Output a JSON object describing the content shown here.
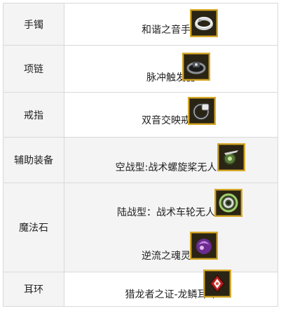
{
  "rows": [
    {
      "label": "手镯",
      "items": [
        {
          "name": "和谐之音手镯",
          "icon": "bracelet-icon"
        }
      ]
    },
    {
      "label": "项链",
      "items": [
        {
          "name": "脉冲触发器",
          "icon": "pulse-trigger-icon"
        }
      ]
    },
    {
      "label": "戒指",
      "items": [
        {
          "name": "双音交映戒指",
          "icon": "ring-icon"
        }
      ]
    },
    {
      "label": "辅助装备",
      "items": [
        {
          "name": "空战型:战术螺旋桨无人机",
          "icon": "propeller-drone-icon"
        }
      ]
    },
    {
      "label": "魔法石",
      "items": [
        {
          "name": "陆战型：战术车轮无人机",
          "icon": "wheel-drone-icon"
        },
        {
          "name": "逆流之魂灵珠",
          "icon": "purple-orb-icon"
        }
      ]
    },
    {
      "label": "耳环",
      "items": [
        {
          "name": "猎龙者之证-龙鳞耳环",
          "icon": "dragon-scale-earring-icon"
        }
      ]
    }
  ],
  "colors": {
    "border": "#d9d9d9",
    "label_bg": "#f4f4f4",
    "icon_frame": "#d7a92a"
  }
}
